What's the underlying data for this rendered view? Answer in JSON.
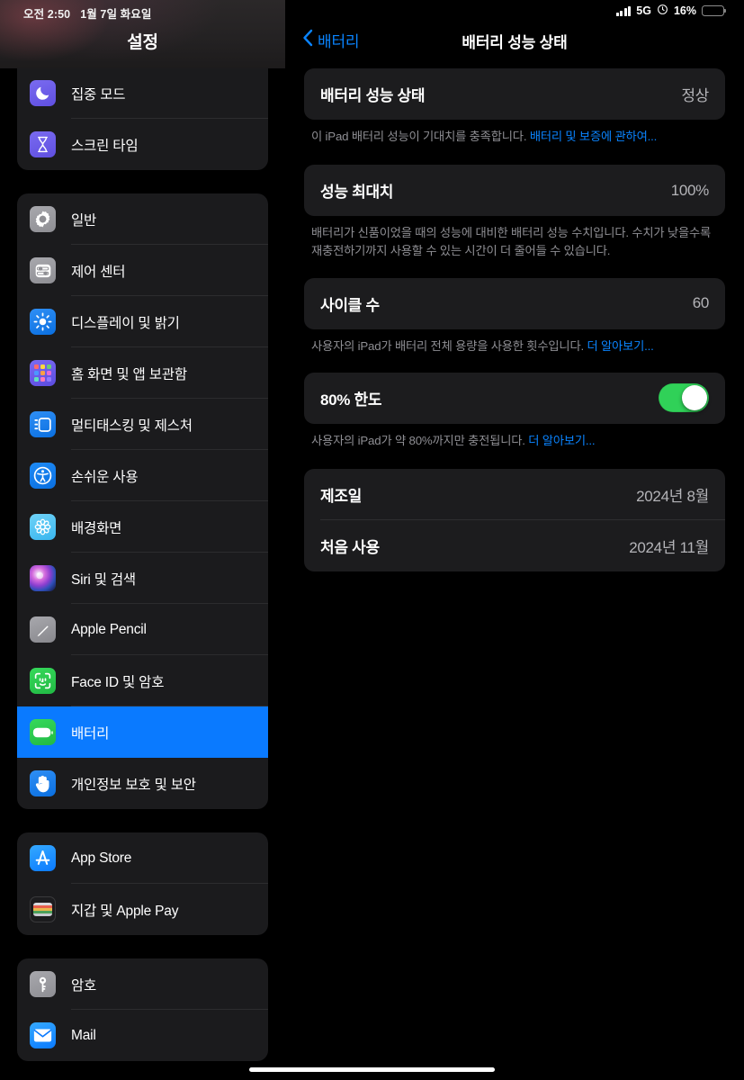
{
  "status_bar": {
    "time": "오전 2:50",
    "date": "1월 7일 화요일",
    "network": "5G",
    "battery_percent": "16%",
    "battery_level": 16,
    "alarm_icon": "alarm-clock-icon",
    "signal_icon": "cellular-signal-icon"
  },
  "sidebar": {
    "title": "설정",
    "groups": [
      {
        "items": [
          {
            "label": "집중 모드",
            "icon": "moon-icon",
            "icon_class": "ic-focus",
            "selected": false
          },
          {
            "label": "스크린 타임",
            "icon": "hourglass-icon",
            "icon_class": "ic-screentime",
            "selected": false
          }
        ]
      },
      {
        "items": [
          {
            "label": "일반",
            "icon": "gear-icon",
            "icon_class": "ic-general",
            "selected": false
          },
          {
            "label": "제어 센터",
            "icon": "sliders-icon",
            "icon_class": "ic-control",
            "selected": false
          },
          {
            "label": "디스플레이 및 밝기",
            "icon": "brightness-sun-icon",
            "icon_class": "ic-display",
            "selected": false
          },
          {
            "label": "홈 화면 및 앱 보관함",
            "icon": "app-grid-icon",
            "icon_class": "ic-home",
            "selected": false
          },
          {
            "label": "멀티태스킹 및 제스처",
            "icon": "multitasking-icon",
            "icon_class": "ic-multitask",
            "selected": false
          },
          {
            "label": "손쉬운 사용",
            "icon": "accessibility-icon",
            "icon_class": "ic-access",
            "selected": false
          },
          {
            "label": "배경화면",
            "icon": "flower-wallpaper-icon",
            "icon_class": "ic-wallpaper",
            "selected": false
          },
          {
            "label": "Siri 및 검색",
            "icon": "siri-orb-icon",
            "icon_class": "ic-siri",
            "selected": false
          },
          {
            "label": "Apple Pencil",
            "icon": "pencil-icon",
            "icon_class": "ic-pencil",
            "selected": false
          },
          {
            "label": "Face ID 및 암호",
            "icon": "face-id-icon",
            "icon_class": "ic-faceid",
            "selected": false
          },
          {
            "label": "배터리",
            "icon": "battery-icon",
            "icon_class": "ic-battery",
            "selected": true
          },
          {
            "label": "개인정보 보호 및 보안",
            "icon": "hand-privacy-icon",
            "icon_class": "ic-privacy",
            "selected": false
          }
        ]
      },
      {
        "items": [
          {
            "label": "App Store",
            "icon": "app-store-icon",
            "icon_class": "ic-appstore",
            "selected": false
          },
          {
            "label": "지갑 및 Apple Pay",
            "icon": "wallet-icon",
            "icon_class": "ic-wallet",
            "selected": false
          }
        ]
      },
      {
        "items": [
          {
            "label": "암호",
            "icon": "key-icon",
            "icon_class": "ic-passwords",
            "selected": false
          },
          {
            "label": "Mail",
            "icon": "mail-envelope-icon",
            "icon_class": "ic-mail",
            "selected": false
          }
        ]
      }
    ]
  },
  "detail": {
    "back_label": "배터리",
    "back_icon": "chevron-left-icon",
    "title": "배터리 성능 상태",
    "sections": {
      "health": {
        "row_label": "배터리 성능 상태",
        "row_value": "정상",
        "footnote_text": "이 iPad 배터리 성능이 기대치를 충족합니다. ",
        "footnote_link": "배터리 및 보증에 관하여..."
      },
      "capacity": {
        "row_label": "성능 최대치",
        "row_value": "100%",
        "footnote_text": "배터리가 신품이었을 때의 성능에 대비한 배터리 성능 수치입니다. 수치가 낮을수록 재충전하기까지 사용할 수 있는 시간이 더 줄어들 수 있습니다.",
        "footnote_link": ""
      },
      "cycles": {
        "row_label": "사이클 수",
        "row_value": "60",
        "footnote_text": "사용자의 iPad가 배터리 전체 용량을 사용한 횟수입니다. ",
        "footnote_link": "더 알아보기..."
      },
      "limit": {
        "row_label": "80% 한도",
        "toggle_state": "on",
        "footnote_text": "사용자의 iPad가 약 80%까지만 충전됩니다. ",
        "footnote_link": "더 알아보기..."
      },
      "dates": {
        "rows": [
          {
            "label": "제조일",
            "value": "2024년 8월"
          },
          {
            "label": "처음 사용",
            "value": "2024년 11월"
          }
        ]
      }
    }
  },
  "colors": {
    "accent_blue": "#0a84ff",
    "selection_blue": "#0a7aff",
    "toggle_green": "#30d158",
    "card_bg": "#1c1c1e",
    "footnote_gray": "#8e8e93"
  }
}
